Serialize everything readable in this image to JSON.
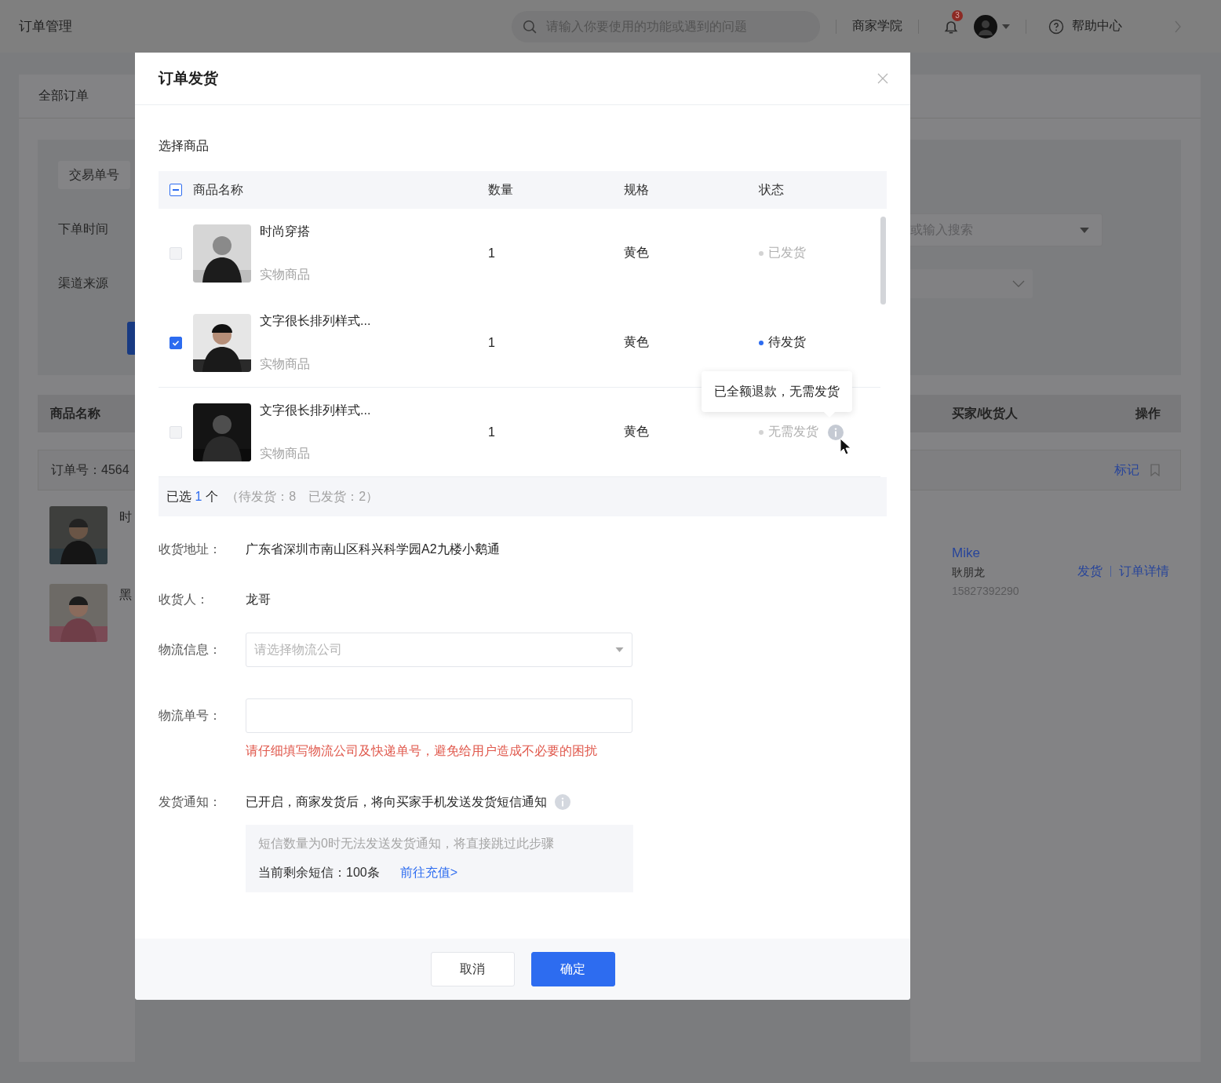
{
  "topbar": {
    "title": "订单管理",
    "search": {
      "placeholder": "请输入你要使用的功能或遇到的问题"
    },
    "academy_link": "商家学院",
    "notification_badge": "3",
    "help_link": "帮助中心"
  },
  "background_left": {
    "tab": "全部订单",
    "order_no_button": "交易单号",
    "filter_labels": [
      "下单时间",
      "渠道来源"
    ],
    "column": "商品名称",
    "order_number": "订单号：4564",
    "items": [
      {
        "kind": "picture",
        "name": "时"
      },
      {
        "kind": "picture",
        "name": "黑"
      }
    ]
  },
  "background_right": {
    "search_select": {
      "placeholder": "或输入搜索"
    },
    "columns": [
      "买家/收货人",
      "操作"
    ],
    "mark_link": "标记",
    "buyer": {
      "nickname": "Mike",
      "name": "耿朋龙",
      "phone": "15827392290"
    },
    "actions": [
      "发货",
      "订单详情"
    ]
  },
  "modal": {
    "title": "订单发货",
    "section_title": "选择商品",
    "header_checkbox": {
      "indeterminate": true
    },
    "columns": [
      "商品名称",
      "数量",
      "规格",
      "状态"
    ],
    "products": [
      {
        "name": "时尚穿搭",
        "type": "实物商品",
        "quantity": "1",
        "spec": "黄色",
        "status": "已发货",
        "kind": "shipped",
        "checked": false,
        "disabled": true
      },
      {
        "name": "文字很长排列样式...",
        "type": "实物商品",
        "quantity": "1",
        "spec": "黄色",
        "status": "待发货",
        "kind": "pending",
        "checked": true,
        "disabled": false
      },
      {
        "name": "文字很长排列样式...",
        "type": "实物商品",
        "quantity": "1",
        "spec": "黄色",
        "status": "无需发货",
        "kind": "none",
        "checked": false,
        "disabled": true,
        "tooltip": "已全额退款，无需发货"
      }
    ],
    "summary": {
      "prefix": "已选",
      "count": "1",
      "unit": "个",
      "detail": "（待发货：8　已发货：2）"
    },
    "address": {
      "label": "收货地址：",
      "value": "广东省深圳市南山区科兴科学园A2九楼小鹅通"
    },
    "receiver": {
      "label": "收货人：",
      "value": "龙哥"
    },
    "logistics": {
      "label": "物流信息：",
      "placeholder": "请选择物流公司"
    },
    "tracking": {
      "label": "物流单号：",
      "hint": "请仔细填写物流公司及快递单号，避免给用户造成不必要的困扰"
    },
    "notification": {
      "label": "发货通知：",
      "text": "已开启，商家发货后，将向买家手机发送发货短信通知",
      "notice": "短信数量为0时无法发送发货通知，将直接跳过此步骤",
      "remaining": "当前剩余短信：100条",
      "recharge_link": "前往充值>"
    },
    "buttons": [
      {
        "label": "取消",
        "kind": "secondary"
      },
      {
        "label": "确定",
        "kind": "primary"
      }
    ]
  }
}
